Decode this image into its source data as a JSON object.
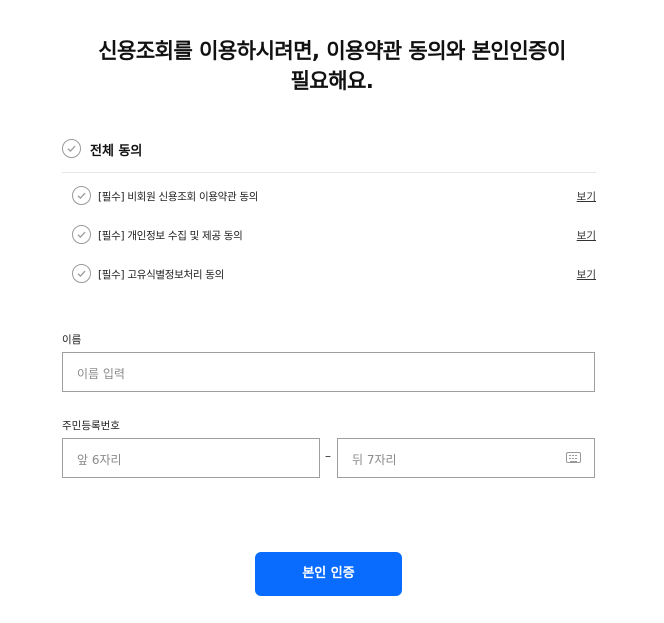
{
  "page": {
    "title_line1": "신용조회를 이용하시려면, 이용약관 동의와 본인인증이",
    "title_line2": "필요해요."
  },
  "agreements": {
    "all_label": "전체 동의",
    "items": [
      {
        "label": "[필수] 비회원 신용조회 이용약관 동의",
        "view": "보기"
      },
      {
        "label": "[필수] 개인정보 수집 및 제공 동의",
        "view": "보기"
      },
      {
        "label": "[필수] 고유식별정보처리 동의",
        "view": "보기"
      }
    ]
  },
  "form": {
    "name_label": "이름",
    "name_placeholder": "이름 입력",
    "rrn_label": "주민등록번호",
    "rrn_front_placeholder": "앞 6자리",
    "rrn_separator": "–",
    "rrn_back_placeholder": "뒤 7자리"
  },
  "submit": {
    "label": "본인 인증"
  },
  "colors": {
    "accent": "#0a6cff",
    "check_border": "#9a9a9a",
    "input_border": "#9e9e9e"
  },
  "icons": {
    "check": "check-icon",
    "keyboard": "keyboard-icon"
  }
}
